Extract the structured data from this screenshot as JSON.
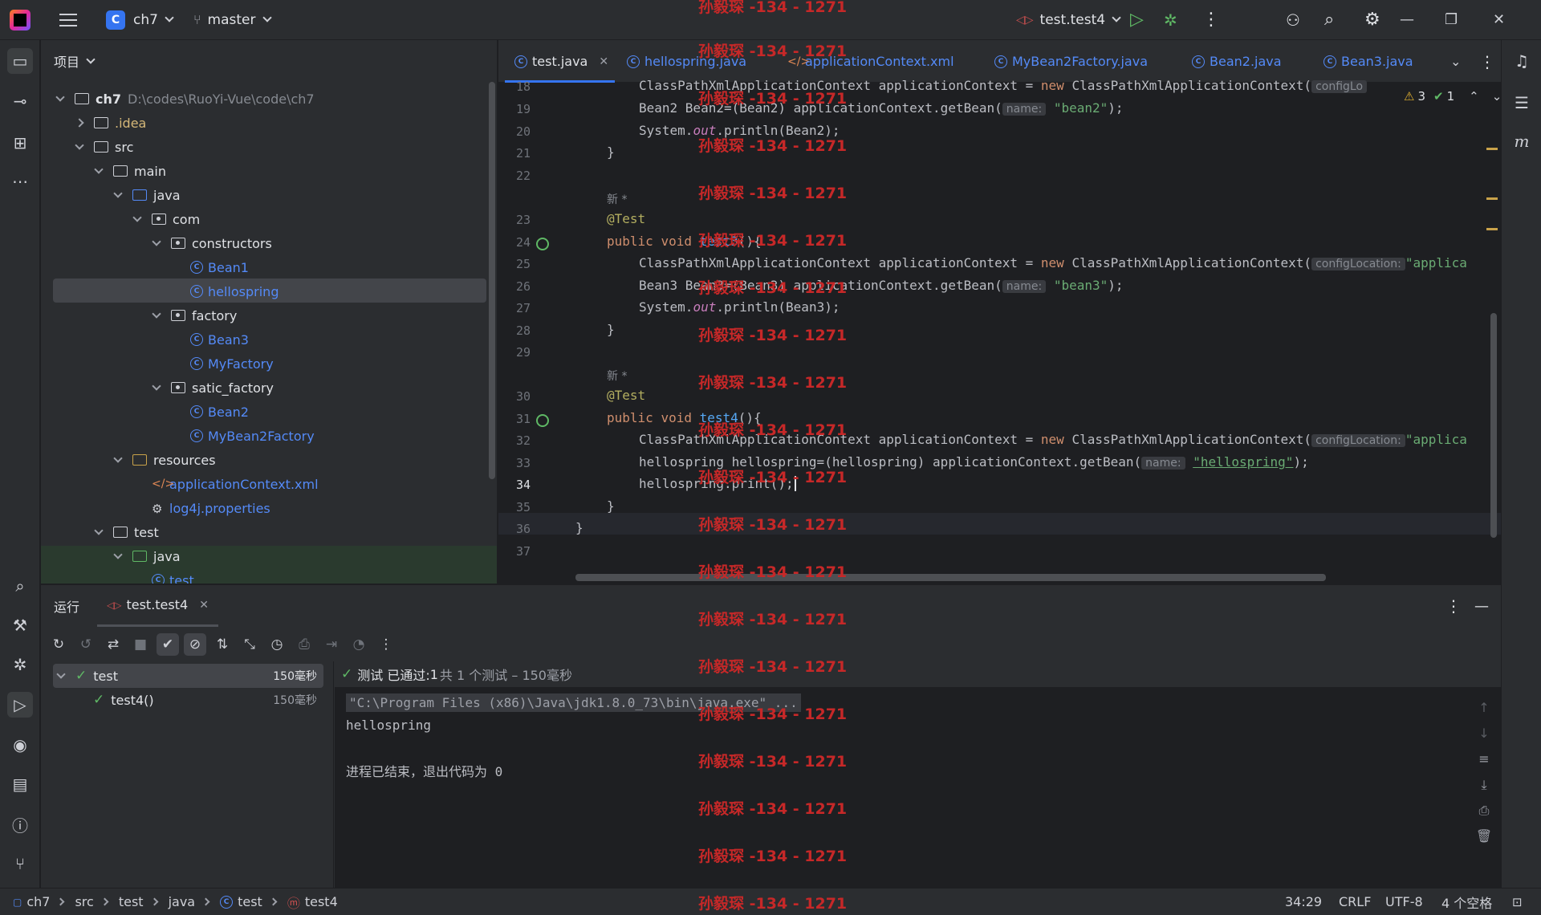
{
  "titlebar": {
    "project_badge": "C",
    "project_name": "ch7",
    "branch": "master",
    "run_config": "test.test4"
  },
  "project_panel": {
    "title": "项目",
    "tree": [
      {
        "label": "ch7",
        "path": "D:\\codes\\RuoYi-Vue\\code\\ch7"
      },
      {
        "label": ".idea"
      },
      {
        "label": "src"
      },
      {
        "label": "main"
      },
      {
        "label": "java"
      },
      {
        "label": "com"
      },
      {
        "label": "constructors"
      },
      {
        "label": "Bean1"
      },
      {
        "label": "hellospring"
      },
      {
        "label": "factory"
      },
      {
        "label": "Bean3"
      },
      {
        "label": "MyFactory"
      },
      {
        "label": "satic_factory"
      },
      {
        "label": "Bean2"
      },
      {
        "label": "MyBean2Factory"
      },
      {
        "label": "resources"
      },
      {
        "label": "applicationContext.xml"
      },
      {
        "label": "log4j.properties"
      },
      {
        "label": "test"
      },
      {
        "label": "java"
      },
      {
        "label": "test"
      }
    ]
  },
  "editor": {
    "tabs": [
      {
        "label": "test.java"
      },
      {
        "label": "hellospring.java"
      },
      {
        "label": "applicationContext.xml"
      },
      {
        "label": "MyBean2Factory.java"
      },
      {
        "label": "Bean2.java"
      },
      {
        "label": "Bean3.java"
      }
    ],
    "inspections": {
      "warnings": "3",
      "ok": "1"
    },
    "new_marker": "新 *",
    "hint_config": "configLocation:",
    "hint_config_short": "configLo",
    "hint_name": "name:",
    "line_numbers": [
      "18",
      "19",
      "20",
      "21",
      "22",
      "23",
      "24",
      "25",
      "26",
      "27",
      "28",
      "29",
      "30",
      "31",
      "32",
      "33",
      "34",
      "35",
      "36",
      "37"
    ],
    "code": {
      "l18_a": "ClassPathXmlApplicationContext applicationContext = ",
      "l18_kw": "new",
      "l18_b": " ClassPathXmlApplicationContext(",
      "l19_a": "Bean2 Bean2=(Bean2) applicationContext.getBean(",
      "l19_str": "\"bean2\"",
      "l19_b": ");",
      "l20_a": "System.",
      "l20_it": "out",
      "l20_b": ".println(Bean2);",
      "brace_close": "}",
      "annotation": "@Test",
      "kw_public": "public",
      "kw_void": "void",
      "l24_fn": "test3",
      "l24_b": "(){",
      "l25_str": "\"applica",
      "l26_a": "Bean3 Bean3=(Bean3) applicationContext.getBean(",
      "l26_str": "\"bean3\"",
      "l27_b": ".println(Bean3);",
      "l31_fn": "test4",
      "l33_a": "hellospring hellospring=(hellospring) applicationContext.getBean(",
      "l33_str": "\"hellospring\"",
      "l34_a": "hellospring.print();"
    }
  },
  "run_panel": {
    "title": "运行",
    "tab": "test.test4",
    "tree": [
      {
        "label": "test",
        "time": "150毫秒"
      },
      {
        "label": "test4()",
        "time": "150毫秒"
      }
    ],
    "status_prefix": "测试 已通过:",
    "status_count": "1",
    "status_suffix": "共 1 个测试 – 150毫秒",
    "console": {
      "cmd": "\"C:\\Program Files (x86)\\Java\\jdk1.8.0_73\\bin\\java.exe\" ...",
      "out1": "hellospring",
      "out2": "进程已结束，退出代码为 0"
    }
  },
  "statusbar": {
    "crumbs": [
      "ch7",
      "src",
      "test",
      "java",
      "test",
      "test4"
    ],
    "position": "34:29",
    "line_sep": "CRLF",
    "encoding": "UTF-8",
    "indent": "4 个空格"
  },
  "watermark": "孙毅琛 -134 - 1271"
}
